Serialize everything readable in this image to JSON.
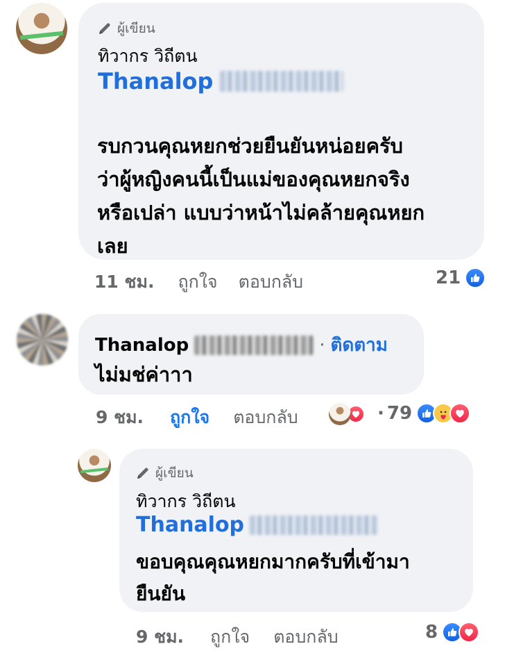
{
  "comment1": {
    "author_badge": "ผู้เขียน",
    "author_name": "ทิวากร วิถีตน",
    "mention": "Thanalop",
    "text_lines": [
      "รบกวนคุณหยกช่วยยืนยันหน่อยครับ",
      "ว่าผู้หญิงคนนี้เป็นแม่ของคุณหยกจริง",
      "หรือเปล่า แบบว่าหน้าไม่คล้ายคุณหยก",
      "เลย"
    ],
    "time": "11 ชม.",
    "like": "ถูกใจ",
    "reply": "ตอบกลับ",
    "reaction_count": "21"
  },
  "comment2": {
    "author_name": "Thanalop",
    "separator": "·",
    "follow": "ติดตาม",
    "text": "ไม่มช่ค่าาา",
    "time": "9 ชม.",
    "like": "ถูกใจ",
    "reply": "ตอบกลับ",
    "separator2": "·",
    "reaction_count": "79"
  },
  "comment3": {
    "author_badge": "ผู้เขียน",
    "author_name": "ทิวากร วิถีตน",
    "mention": "Thanalop",
    "text_lines": [
      "ขอบคุณคุณหยกมากครับที่เข้ามา",
      "ยืนยัน"
    ],
    "time": "9 ชม.",
    "like": "ถูกใจ",
    "reply": "ตอบกลับ",
    "reaction_count": "8"
  },
  "colors": {
    "link": "#216fdb",
    "like_active": "#1877f2",
    "bubble": "#f0f2f5",
    "meta": "#65676b"
  }
}
